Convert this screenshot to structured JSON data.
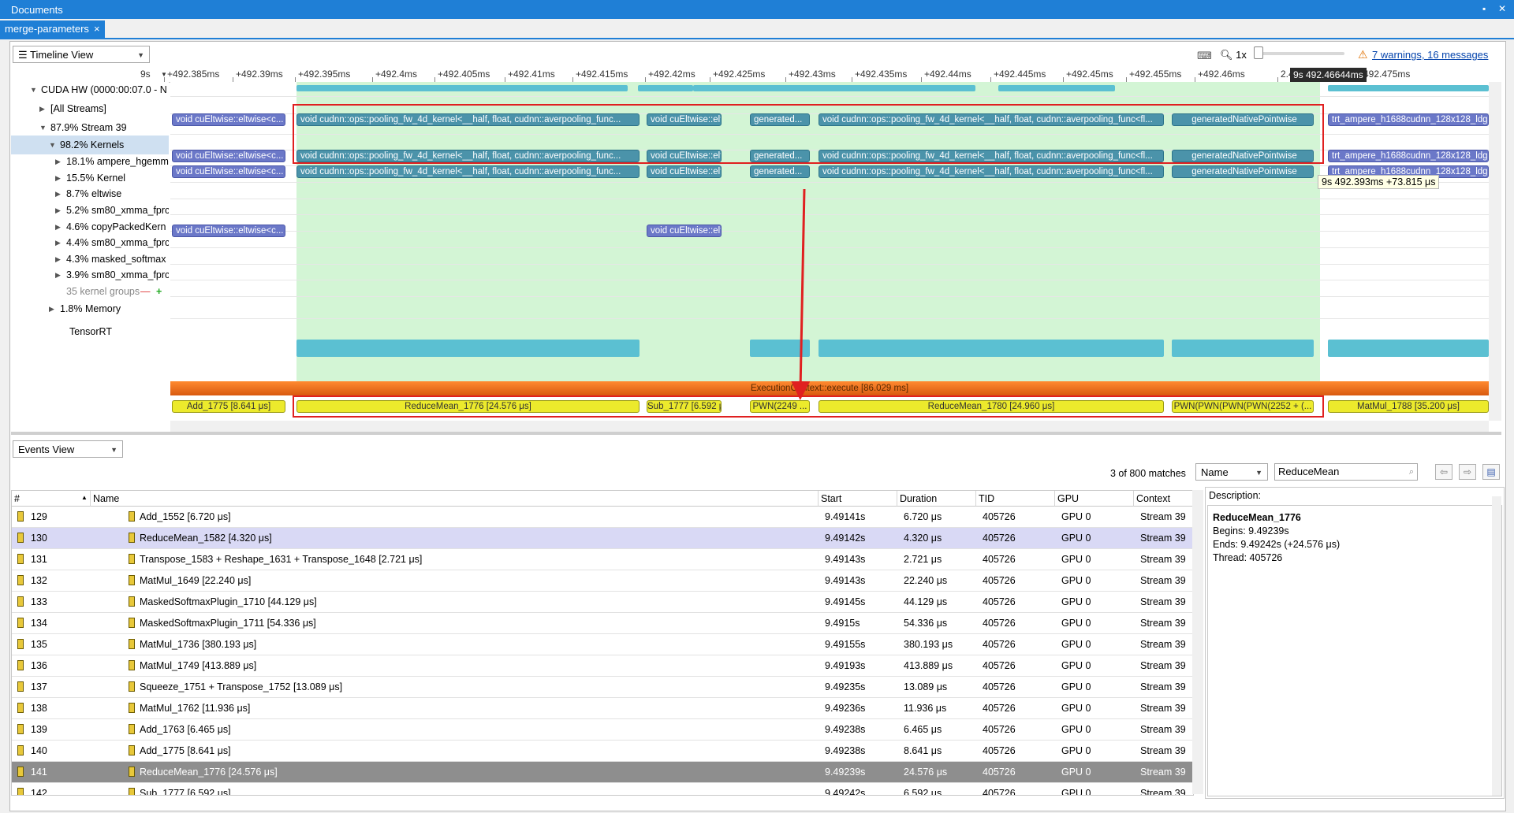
{
  "window": {
    "title": "Documents",
    "tab_label": "merge-parameters",
    "tab_close": "×",
    "pin": "▪",
    "close": "✕"
  },
  "toolbar": {
    "view_combo": "Timeline View",
    "zoom_label": "1x",
    "warnings": "7 warnings, 16 messages"
  },
  "ruler": {
    "prefix": "9s",
    "ticks": [
      "+492.385ms",
      "+492.39ms",
      "+492.395ms",
      "+492.4ms",
      "+492.405ms",
      "+492.41ms",
      "+492.415ms",
      "+492.42ms",
      "+492.425ms",
      "+492.43ms",
      "+492.435ms",
      "+492.44ms",
      "+492.445ms",
      "+492.45ms",
      "+492.455ms",
      "+492.46ms",
      "2.47ms",
      "+492.475ms"
    ],
    "cursor": "9s 492.46644ms"
  },
  "tree": [
    {
      "label": "CUDA HW (0000:00:07.0 - N",
      "toggle": "▼"
    },
    {
      "label": "[All Streams]",
      "toggle": "▶"
    },
    {
      "label": "87.9% Stream 39",
      "toggle": "▼"
    },
    {
      "label": "98.2% Kernels",
      "toggle": "▼"
    },
    {
      "label": "18.1% ampere_hgemm",
      "toggle": "▶"
    },
    {
      "label": "15.5% Kernel",
      "toggle": "▶"
    },
    {
      "label": "8.7% eltwise",
      "toggle": "▶"
    },
    {
      "label": "5.2% sm80_xmma_fprc",
      "toggle": "▶"
    },
    {
      "label": "4.6% copyPackedKern",
      "toggle": "▶"
    },
    {
      "label": "4.4% sm80_xmma_fprc",
      "toggle": "▶"
    },
    {
      "label": "4.3% masked_softmax",
      "toggle": "▶"
    },
    {
      "label": "3.9% sm80_xmma_fprc",
      "toggle": "▶"
    },
    {
      "label": "35 kernel groups",
      "toggle": ""
    },
    {
      "label": "1.8% Memory",
      "toggle": "▶"
    },
    {
      "label": "TensorRT",
      "toggle": ""
    }
  ],
  "kernel_groups_controls": {
    "minus": "—",
    "plus": "+"
  },
  "timeline": {
    "kernels": [
      "void cuEltwise::eltwise<c...",
      "void cudnn::ops::pooling_fw_4d_kernel<__half, float, cudnn::averpooling_func...",
      "void cuEltwise::elt...",
      "generated...",
      "void cudnn::ops::pooling_fw_4d_kernel<__half, float, cudnn::averpooling_func<fl...",
      "generatedNativePointwise",
      "trt_ampere_h1688cudnn_128x128_ldg..."
    ],
    "eltwise_row": [
      "void cuEltwise::eltwise<c...",
      "void cuEltwise::elt..."
    ],
    "exec_label": "ExecutionContext::execute [86.029 ms]",
    "trt_blocks": [
      "Add_1775 [8.641 μs]",
      "ReduceMean_1776 [24.576 μs]",
      "Sub_1777 [6.592 μs]",
      "PWN(2249 ...",
      "ReduceMean_1780 [24.960 μs]",
      "PWN(PWN(PWN(PWN(2252 + (...",
      "MatMul_1788 [35.200 μs]"
    ],
    "tooltip": "9s 492.393ms +73.815 μs"
  },
  "events": {
    "view_combo": "Events View",
    "matches": "3 of 800 matches",
    "field_combo": "Name",
    "search_value": "ReduceMean",
    "columns": [
      "#",
      "Name",
      "Start",
      "Duration",
      "TID",
      "GPU",
      "Context"
    ],
    "rows": [
      {
        "n": "129",
        "name": "Add_1552 [6.720 μs]",
        "start": "9.49141s",
        "dur": "6.720 μs",
        "tid": "405726",
        "gpu": "GPU 0",
        "ctx": "Stream 39"
      },
      {
        "n": "130",
        "name": "ReduceMean_1582 [4.320 μs]",
        "start": "9.49142s",
        "dur": "4.320 μs",
        "tid": "405726",
        "gpu": "GPU 0",
        "ctx": "Stream 39"
      },
      {
        "n": "131",
        "name": "Transpose_1583 + Reshape_1631 + Transpose_1648 [2.721 μs]",
        "start": "9.49143s",
        "dur": "2.721 μs",
        "tid": "405726",
        "gpu": "GPU 0",
        "ctx": "Stream 39"
      },
      {
        "n": "132",
        "name": "MatMul_1649 [22.240 μs]",
        "start": "9.49143s",
        "dur": "22.240 μs",
        "tid": "405726",
        "gpu": "GPU 0",
        "ctx": "Stream 39"
      },
      {
        "n": "133",
        "name": "MaskedSoftmaxPlugin_1710 [44.129 μs]",
        "start": "9.49145s",
        "dur": "44.129 μs",
        "tid": "405726",
        "gpu": "GPU 0",
        "ctx": "Stream 39"
      },
      {
        "n": "134",
        "name": "MaskedSoftmaxPlugin_1711 [54.336 μs]",
        "start": "9.4915s",
        "dur": "54.336 μs",
        "tid": "405726",
        "gpu": "GPU 0",
        "ctx": "Stream 39"
      },
      {
        "n": "135",
        "name": "MatMul_1736 [380.193 μs]",
        "start": "9.49155s",
        "dur": "380.193 μs",
        "tid": "405726",
        "gpu": "GPU 0",
        "ctx": "Stream 39"
      },
      {
        "n": "136",
        "name": "MatMul_1749 [413.889 μs]",
        "start": "9.49193s",
        "dur": "413.889 μs",
        "tid": "405726",
        "gpu": "GPU 0",
        "ctx": "Stream 39"
      },
      {
        "n": "137",
        "name": "Squeeze_1751 + Transpose_1752 [13.089 μs]",
        "start": "9.49235s",
        "dur": "13.089 μs",
        "tid": "405726",
        "gpu": "GPU 0",
        "ctx": "Stream 39"
      },
      {
        "n": "138",
        "name": "MatMul_1762 [11.936 μs]",
        "start": "9.49236s",
        "dur": "11.936 μs",
        "tid": "405726",
        "gpu": "GPU 0",
        "ctx": "Stream 39"
      },
      {
        "n": "139",
        "name": "Add_1763 [6.465 μs]",
        "start": "9.49238s",
        "dur": "6.465 μs",
        "tid": "405726",
        "gpu": "GPU 0",
        "ctx": "Stream 39"
      },
      {
        "n": "140",
        "name": "Add_1775 [8.641 μs]",
        "start": "9.49238s",
        "dur": "8.641 μs",
        "tid": "405726",
        "gpu": "GPU 0",
        "ctx": "Stream 39"
      },
      {
        "n": "141",
        "name": "ReduceMean_1776 [24.576 μs]",
        "start": "9.49239s",
        "dur": "24.576 μs",
        "tid": "405726",
        "gpu": "GPU 0",
        "ctx": "Stream 39"
      },
      {
        "n": "142",
        "name": "Sub_1777 [6.592 μs]",
        "start": "9.49242s",
        "dur": "6.592 μs",
        "tid": "405726",
        "gpu": "GPU 0",
        "ctx": "Stream 39"
      }
    ]
  },
  "description": {
    "label": "Description:",
    "title": "ReduceMean_1776",
    "begins": "Begins: 9.49239s",
    "ends": "Ends: 9.49242s (+24.576 μs)",
    "thread": "Thread: 405726"
  },
  "colors": {
    "accent": "#1f7fd6",
    "highlight": "#d3f5d5",
    "kernel": "#4b93aa",
    "tensorrt": "#ecea2c",
    "annotation": "#e02020"
  }
}
